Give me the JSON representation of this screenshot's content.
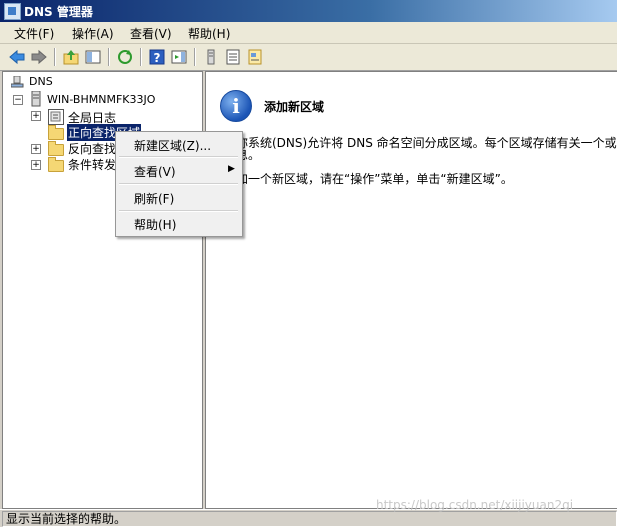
{
  "window": {
    "title": "DNS 管理器"
  },
  "menubar": {
    "items": [
      "文件(F)",
      "操作(A)",
      "查看(V)",
      "帮助(H)"
    ]
  },
  "toolbar": {
    "icons": [
      "back-arrow-icon",
      "forward-arrow-icon",
      "up-folder-icon",
      "show-hide-tree-icon",
      "refresh-icon",
      "help-icon",
      "action-pane-icon",
      "server-icon",
      "list-icon",
      "properties-icon"
    ]
  },
  "tree": {
    "root": "DNS",
    "server": "WIN-BHMNMFK33JO",
    "children": [
      "全局日志",
      "正向查找区域",
      "反向查找",
      "条件转发"
    ]
  },
  "context_menu": {
    "items": [
      "新建区域(Z)...",
      "查看(V)",
      "刷新(F)",
      "帮助(H)"
    ]
  },
  "content": {
    "heading": "添加新区域",
    "line1": "称系统(DNS)允许将 DNS 命名空间分成区域。每个区域存储有关一个或",
    "line2": "息。",
    "line3": "加一个新区域，请在“操作”菜单，单击“新建区域”。"
  },
  "status": {
    "text": "显示当前选择的帮助。"
  },
  "watermark": "https://blog.csdn.net/xiijiyuan2qi",
  "colors": {
    "titlebar": "#0a246a",
    "selection": "#0a246a",
    "menu_bg": "#ece9d8"
  }
}
